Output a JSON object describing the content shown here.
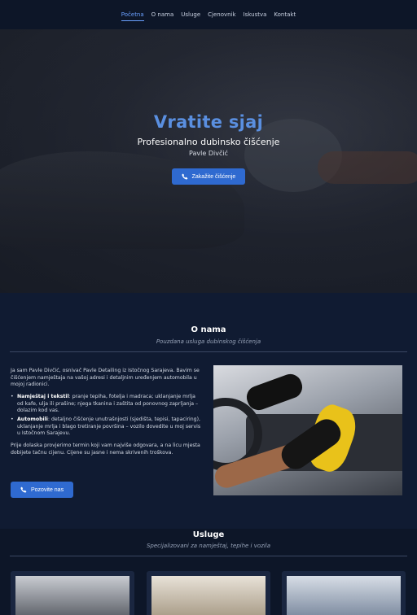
{
  "nav": {
    "items": [
      "Početna",
      "O nama",
      "Usluge",
      "Cjenovnik",
      "Iskustva",
      "Kontakt"
    ],
    "active_index": 0
  },
  "hero": {
    "title": "Vratite sjaj",
    "subtitle": "Profesionalno dubinsko čišćenje",
    "owner": "Pavle Divčić",
    "cta_label": "Zakažite čišćenje",
    "icon": "phone-icon"
  },
  "about": {
    "title": "O nama",
    "subtitle": "Pouzdana usluga dubinskog čišćenja",
    "intro": "Ja sam Pavle Divčić, osnivač Pavle Detailing iz Istočnog Sarajeva. Bavim se čišćenjem namještaja na vašoj adresi i detaljnim uređenjem automobila u mojoj radionici.",
    "bullets": [
      {
        "bold": "Namještaj i tekstil",
        "text": ": pranje tepiha, fotelja i madraca; uklanjanje mrlja od kafe, ulja ili prašine; njega tkanina i zaštita od ponovnog zaprljanja – dolazim kod vas."
      },
      {
        "bold": "Automobili",
        "text": ": detaljno čišćenje unutrašnjosti (sjedišta, tepisi, tapaciring), uklanjanje mrlja i blago tretiranje površina – vozilo dovedite u moj servis u Istočnom Sarajevu."
      }
    ],
    "outro": "Prije dolaska provjerimo termin koji vam najviše odgovara, a na licu mjesta dobijete tačnu cijenu. Cijene su jasne i nema skrivenih troškova.",
    "cta_label": "Pozovite nas"
  },
  "services": {
    "title": "Usluge",
    "subtitle": "Specijalizovani za namještaj, tepihe i vozila"
  },
  "colors": {
    "accent": "#2f6ad0",
    "title_blue": "#5a8fe0",
    "bg": "#0f1a30"
  }
}
